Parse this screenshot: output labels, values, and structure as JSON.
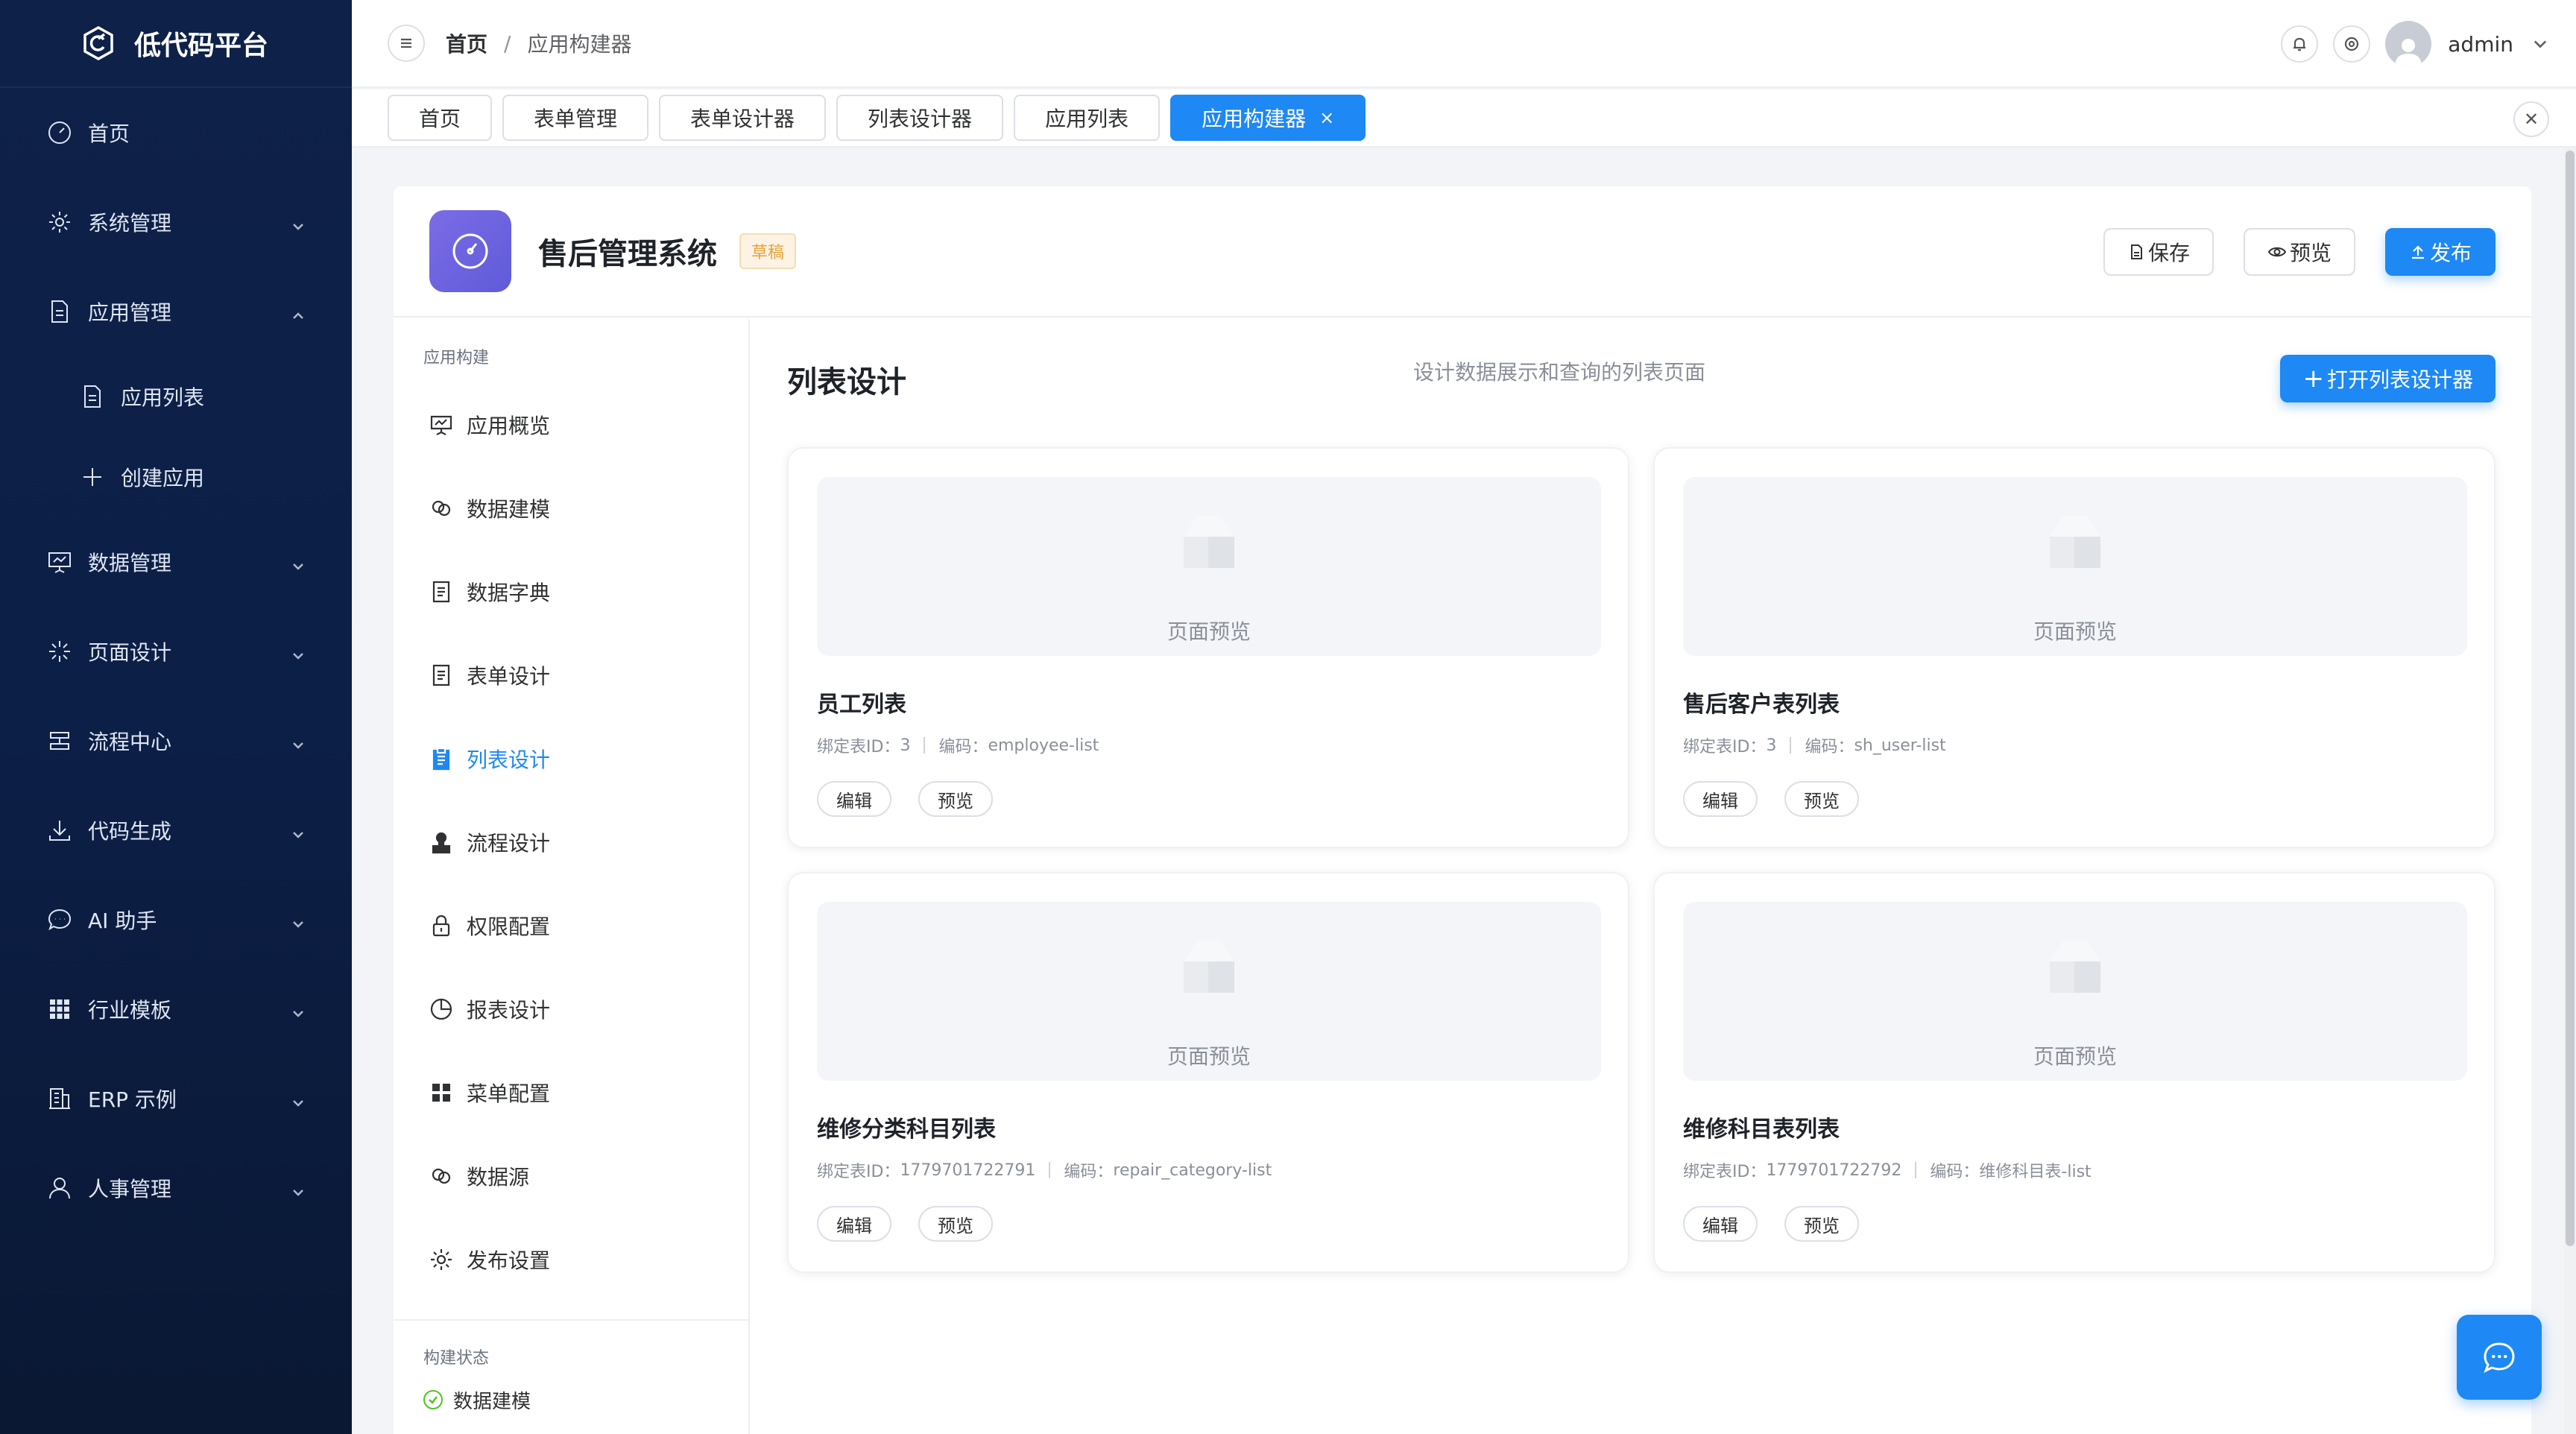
{
  "brand": {
    "title": "低代码平台"
  },
  "sidebar": {
    "items": [
      {
        "label": "首页",
        "icon": "dashboard-icon"
      },
      {
        "label": "系统管理",
        "icon": "gear-icon"
      },
      {
        "label": "应用管理",
        "icon": "document-icon"
      },
      {
        "label": "应用列表",
        "icon": "document-icon"
      },
      {
        "label": "创建应用",
        "icon": "plus-icon"
      },
      {
        "label": "数据管理",
        "icon": "presentation-icon"
      },
      {
        "label": "页面设计",
        "icon": "sparkle-icon"
      },
      {
        "label": "流程中心",
        "icon": "flow-icon"
      },
      {
        "label": "代码生成",
        "icon": "download-icon"
      },
      {
        "label": "AI 助手",
        "icon": "chat-icon"
      },
      {
        "label": "行业模板",
        "icon": "grid-icon"
      },
      {
        "label": "ERP 示例",
        "icon": "building-icon"
      },
      {
        "label": "人事管理",
        "icon": "user-icon"
      }
    ]
  },
  "header": {
    "breadcrumb": [
      "首页",
      "/",
      "应用构建器"
    ],
    "username": "admin"
  },
  "tabs": [
    {
      "label": "首页"
    },
    {
      "label": "表单管理"
    },
    {
      "label": "表单设计器"
    },
    {
      "label": "列表设计器"
    },
    {
      "label": "应用列表"
    },
    {
      "label": "应用构建器",
      "close": "×"
    }
  ],
  "app": {
    "title": "售后管理系统",
    "status": "草稿",
    "buttons": {
      "save": "保存",
      "preview": "预览",
      "publish": "发布"
    }
  },
  "leftnav": {
    "section": "应用构建",
    "items": [
      {
        "label": "应用概览",
        "icon": "presentation-icon"
      },
      {
        "label": "数据建模",
        "icon": "link-icon"
      },
      {
        "label": "数据字典",
        "icon": "document-icon"
      },
      {
        "label": "表单设计",
        "icon": "document-icon"
      },
      {
        "label": "列表设计",
        "icon": "clipboard-icon"
      },
      {
        "label": "流程设计",
        "icon": "stamp-icon"
      },
      {
        "label": "权限配置",
        "icon": "lock-icon"
      },
      {
        "label": "报表设计",
        "icon": "pie-icon"
      },
      {
        "label": "菜单配置",
        "icon": "grid-icon"
      },
      {
        "label": "数据源",
        "icon": "link-icon"
      },
      {
        "label": "发布设置",
        "icon": "gear-icon"
      }
    ],
    "status_section": "构建状态",
    "status_items": [
      {
        "label": "数据建模"
      }
    ]
  },
  "content": {
    "title": "列表设计",
    "description": "设计数据展示和查询的列表页面",
    "open_button": "打开列表设计器",
    "preview_label": "页面预览",
    "bind_label": "绑定表ID：",
    "code_label": "编码：",
    "edit_label": "编辑",
    "view_label": "预览",
    "cards": [
      {
        "name": "员工列表",
        "table_id": "3",
        "code": "employee-list"
      },
      {
        "name": "售后客户表列表",
        "table_id": "3",
        "code": "sh_user-list"
      },
      {
        "name": "维修分类科目列表",
        "table_id": "1779701722791",
        "code": "repair_category-list"
      },
      {
        "name": "维修科目表列表",
        "table_id": "1779701722792",
        "code": "维修科目表-list"
      }
    ]
  },
  "colors": {
    "primary": "#1e88f4",
    "sidebar": "#0e2148",
    "draft": "#e6a23c"
  }
}
